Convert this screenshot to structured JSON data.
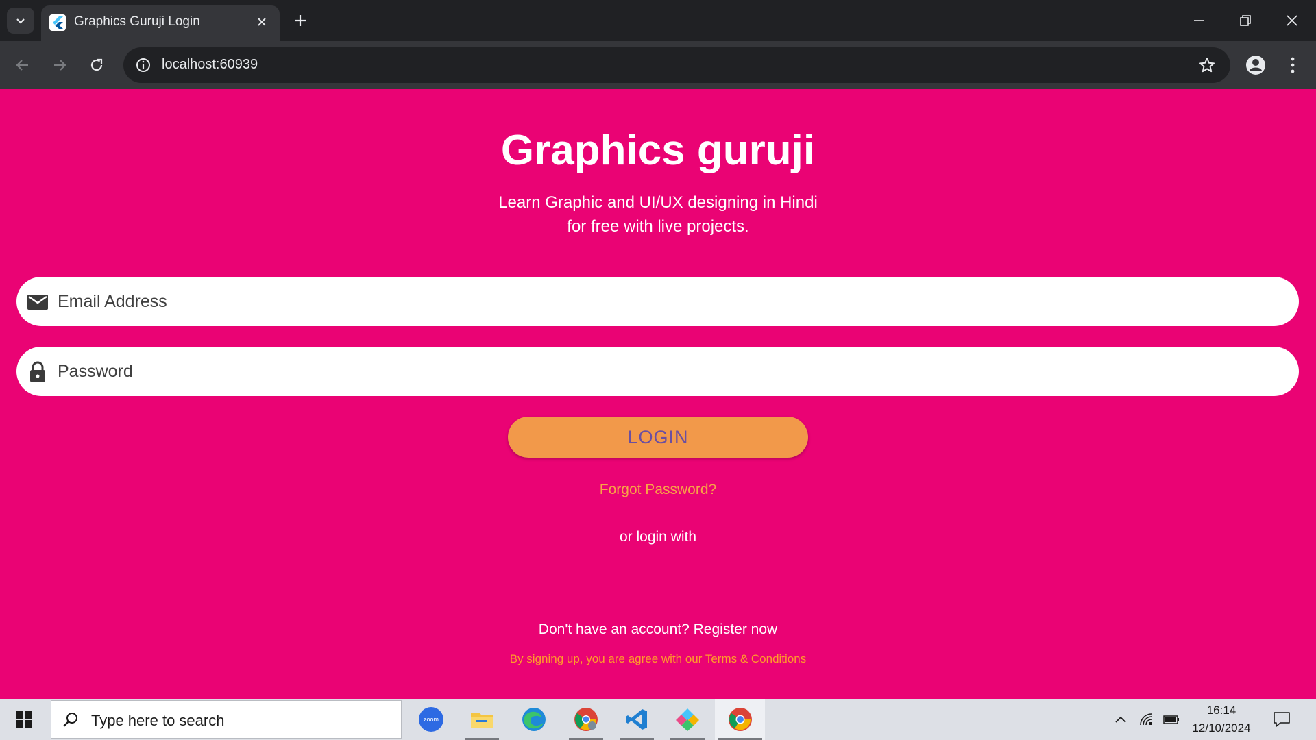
{
  "browser": {
    "tab_title": "Graphics Guruji Login",
    "url": "localhost:60939"
  },
  "page": {
    "title": "Graphics guruji",
    "tagline_line1": "Learn Graphic and UI/UX designing in Hindi",
    "tagline_line2": "for free with live projects.",
    "email_placeholder": "Email Address",
    "password_placeholder": "Password",
    "login_label": "LOGIN",
    "forgot_label": "Forgot Password?",
    "or_login_with": "or login with",
    "register_text": "Don't have an account? Register now",
    "terms_text": "By signing up, you are agree with our Terms & Conditions",
    "colors": {
      "background": "#ea0374",
      "button": "#f2994a",
      "button_text": "#6b4fa0",
      "link": "#f7a446"
    }
  },
  "taskbar": {
    "search_placeholder": "Type here to search",
    "time": "16:14",
    "date": "12/10/2024",
    "apps": [
      "zoom-icon",
      "file-explorer-icon",
      "edge-icon",
      "chrome-profile-icon",
      "vscode-icon",
      "flutter-tool-icon",
      "chrome-icon"
    ]
  }
}
